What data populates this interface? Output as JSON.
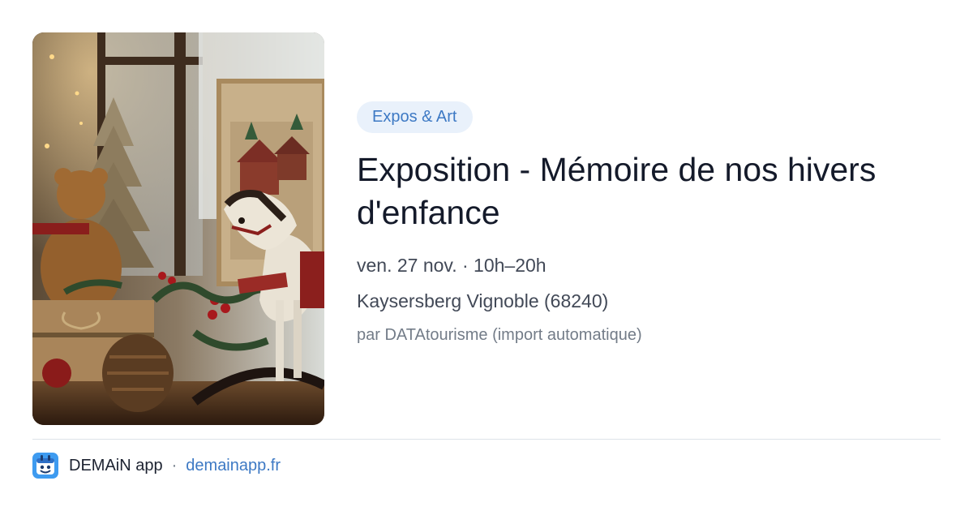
{
  "event": {
    "category": "Expos & Art",
    "title": "Exposition - Mémoire de nos hivers d'enfance",
    "date_time": "ven. 27 nov. · 10h–20h",
    "location": "Kaysersberg Vignoble (68240)",
    "source": "par DATAtourisme (import automatique)"
  },
  "footer": {
    "app_name": "DEMAiN app",
    "separator": "·",
    "site": "demainapp.fr"
  },
  "icons": {
    "image": "vintage-christmas-rocking-horse-photo",
    "app": "demain-app-logo-icon"
  },
  "colors": {
    "accent": "#3d79c4",
    "tag_background": "#e9f1fb",
    "title": "#141a2a"
  }
}
